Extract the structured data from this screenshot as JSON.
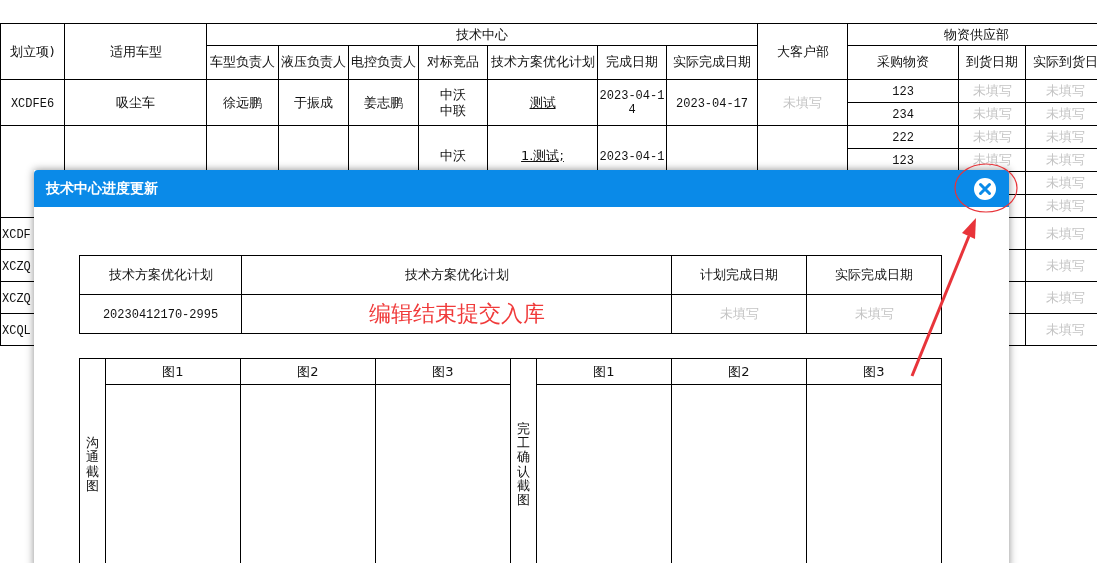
{
  "table": {
    "left_columns": [
      "划立项)",
      "适用车型"
    ],
    "tech_group": {
      "label": "技术中心",
      "columns": [
        "车型负责人",
        "液压负责人",
        "电控负责人",
        "对标竞品",
        "技术方案优化计划",
        "完成日期",
        "实际完成日期"
      ]
    },
    "customer_column": "大客户部",
    "supply_group": {
      "label": "物资供应部",
      "columns": [
        "采购物资",
        "到货日期",
        "实际到货日"
      ]
    },
    "rows": [
      {
        "id": "XCDFE6",
        "model": "吸尘车",
        "leads": [
          "徐远鹏",
          "于振成",
          "姜志鹏"
        ],
        "benchmark": [
          "中沃",
          "中联"
        ],
        "plan": [
          "测试"
        ],
        "plan_date": "2023-04-14",
        "actual_date": "2023-04-17",
        "customer": {
          "text": "未填写",
          "blank": true
        },
        "materials": [
          {
            "item": "123",
            "arrival": {
              "text": "未填写",
              "blank": true
            },
            "actual_arrival": {
              "text": "未填写",
              "blank": true
            }
          },
          {
            "item": "234",
            "arrival": {
              "text": "未填写",
              "blank": true
            },
            "actual_arrival": {
              "text": "未填写",
              "blank": true
            }
          }
        ]
      },
      {
        "benchmark": [
          "中沃"
        ],
        "plan": [
          "1.测试;"
        ],
        "plan_date": "2023-04-1",
        "materials": [
          {
            "item": "222",
            "arrival": {
              "text": "未填写",
              "blank": true
            },
            "actual_arrival": {
              "text": "未填写",
              "blank": true
            }
          },
          {
            "item": "123",
            "arrival": {
              "text": "未填写",
              "blank": true
            },
            "actual_arrival": {
              "text": "未填写",
              "blank": true
            }
          },
          {
            "actual_arrival": {
              "text": "未填写",
              "blank": true
            }
          },
          {
            "actual_arrival": {
              "text": "未填写",
              "blank": true
            }
          }
        ]
      },
      {
        "id": "XCDF",
        "materials": [
          {
            "actual_arrival": {
              "text": "未填写",
              "blank": true
            }
          }
        ]
      },
      {
        "id": "XCZQ",
        "materials": [
          {
            "actual_arrival": {
              "text": "未填写",
              "blank": true
            }
          }
        ]
      },
      {
        "id": "XCZQ",
        "materials": [
          {
            "actual_arrival": {
              "text": "未填写",
              "blank": true
            }
          }
        ]
      },
      {
        "id": "XCQL",
        "materials": [
          {
            "actual_arrival": {
              "text": "未填写",
              "blank": true
            }
          }
        ]
      }
    ]
  },
  "dialog": {
    "title": "技术中心进度更新",
    "plan_table": {
      "columns": [
        "技术方案优化计划",
        "技术方案优化计划",
        "计划完成日期",
        "实际完成日期"
      ],
      "row": {
        "code": "20230412170-2995",
        "plan": "编辑结束提交入库",
        "planned_date": {
          "text": "未填写",
          "blank": true
        },
        "actual_date": {
          "text": "未填写",
          "blank": true
        }
      }
    },
    "screenshot_table": {
      "groups": [
        {
          "label": "沟通截图",
          "columns": [
            "图1",
            "图2",
            "图3"
          ]
        },
        {
          "label": "完工确认截图",
          "columns": [
            "图1",
            "图2",
            "图3"
          ]
        }
      ]
    }
  }
}
